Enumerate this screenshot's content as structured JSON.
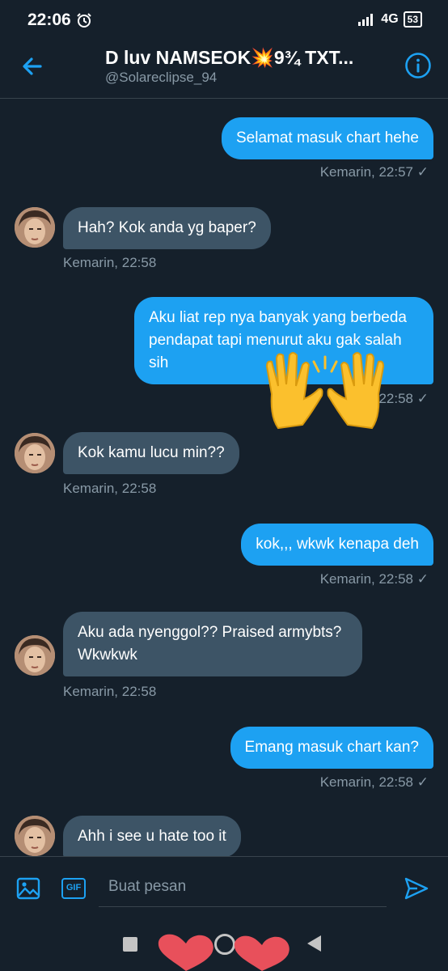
{
  "status": {
    "time": "22:06",
    "network": "4G",
    "battery": "53"
  },
  "header": {
    "name": "D luv NAMSEOK💥9¾ TXT...",
    "handle": "@Solareclipse_94"
  },
  "messages": [
    {
      "direction": "out",
      "text": "Selamat masuk chart hehe",
      "time": "Kemarin, 22:57"
    },
    {
      "direction": "in",
      "text": "Hah? Kok anda yg baper?",
      "time": "Kemarin, 22:58"
    },
    {
      "direction": "out",
      "text": "Aku liat rep nya banyak yang berbeda pendapat tapi menurut aku gak salah sih",
      "time": "22:58"
    },
    {
      "direction": "in",
      "text": "Kok kamu lucu min??",
      "time": "Kemarin, 22:58"
    },
    {
      "direction": "out",
      "text": "kok,,, wkwk kenapa deh",
      "time": "Kemarin, 22:58"
    },
    {
      "direction": "in",
      "text": "Aku ada nyenggol?? Praised armybts? Wkwkwk",
      "time": "Kemarin, 22:58"
    },
    {
      "direction": "out",
      "text": "Emang masuk chart kan?",
      "time": "Kemarin, 22:58"
    },
    {
      "direction": "in",
      "text": "Ahh i see u hate too it",
      "time": ""
    }
  ],
  "compose": {
    "placeholder": "Buat pesan",
    "gif_label": "GIF"
  },
  "colors": {
    "accent": "#1da1f2",
    "background": "#15202b",
    "incoming_bubble": "#3d5466",
    "muted": "#8899a6"
  },
  "icons": [
    "back-arrow-icon",
    "info-icon",
    "image-icon",
    "gif-icon",
    "send-icon",
    "read-check-icon",
    "alarm-icon",
    "signal-icon",
    "raising-hands-emoji",
    "heart-sticker"
  ]
}
